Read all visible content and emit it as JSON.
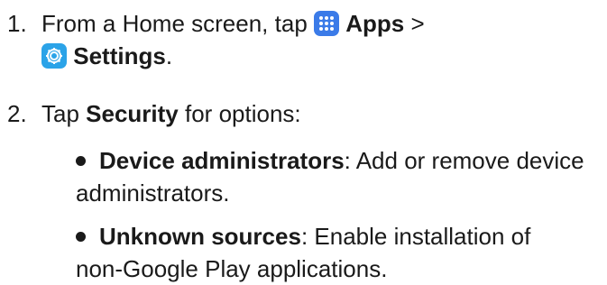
{
  "step1": {
    "number": "1.",
    "line1_prefix": "From a Home screen, tap",
    "apps_label": "Apps",
    "separator": ">",
    "settings_label": "Settings",
    "settings_suffix": ".",
    "apps_icon": "apps-grid-icon",
    "settings_icon": "gear-icon"
  },
  "step2": {
    "number": "2.",
    "prefix": "Tap",
    "security_label": "Security",
    "suffix": "for options:"
  },
  "bullets": [
    {
      "term": "Device administrators",
      "colon": ":",
      "line1": "Add or remove device",
      "line2": "administrators."
    },
    {
      "term": "Unknown sources",
      "colon": ":",
      "line1": "Enable installation of",
      "line2": "non-Google Play applications."
    }
  ],
  "colors": {
    "text": "#1a1a1a",
    "apps_icon_bg": "#3b7be8",
    "settings_icon_bg": "#2ba3e8"
  }
}
